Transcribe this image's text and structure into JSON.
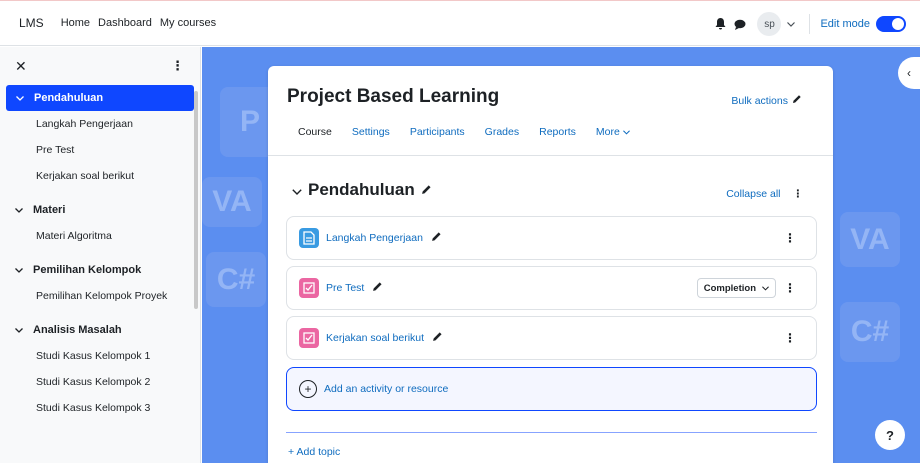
{
  "topbar": {
    "brand": "LMS",
    "links": [
      "Home",
      "Dashboard",
      "My courses"
    ],
    "avatar_initials": "sp",
    "edit_mode_label": "Edit mode",
    "edit_mode_on": true
  },
  "drawer": {
    "sections": [
      {
        "title": "Pendahuluan",
        "active": true,
        "items": [
          "Langkah Pengerjaan",
          "Pre Test",
          "Kerjakan soal berikut"
        ]
      },
      {
        "title": "Materi",
        "active": false,
        "items": [
          "Materi Algoritma"
        ]
      },
      {
        "title": "Pemilihan Kelompok",
        "active": false,
        "items": [
          "Pemilihan Kelompok Proyek"
        ]
      },
      {
        "title": "Analisis Masalah",
        "active": false,
        "items": [
          "Studi Kasus Kelompok 1",
          "Studi Kasus Kelompok 2",
          "Studi Kasus Kelompok 3"
        ]
      }
    ]
  },
  "course": {
    "title": "Project Based Learning",
    "bulk_actions": "Bulk actions",
    "tabs": [
      "Course",
      "Settings",
      "Participants",
      "Grades",
      "Reports",
      "More"
    ],
    "section_title": "Pendahuluan",
    "collapse_all": "Collapse all",
    "activities": [
      {
        "name": "Langkah Pengerjaan",
        "type": "page",
        "color": "#399be2"
      },
      {
        "name": "Pre Test",
        "type": "quiz",
        "color": "#eb66a2",
        "completion": "Completion"
      },
      {
        "name": "Kerjakan soal berikut",
        "type": "quiz",
        "color": "#eb66a2"
      }
    ],
    "add_activity": "Add an activity or resource",
    "add_topic": "+ Add topic"
  },
  "background": {
    "color": "#5b8ef0",
    "accent": "#0f47ff",
    "decor_labels": [
      "P",
      "VA",
      "C#",
      "VA",
      "C#"
    ]
  }
}
